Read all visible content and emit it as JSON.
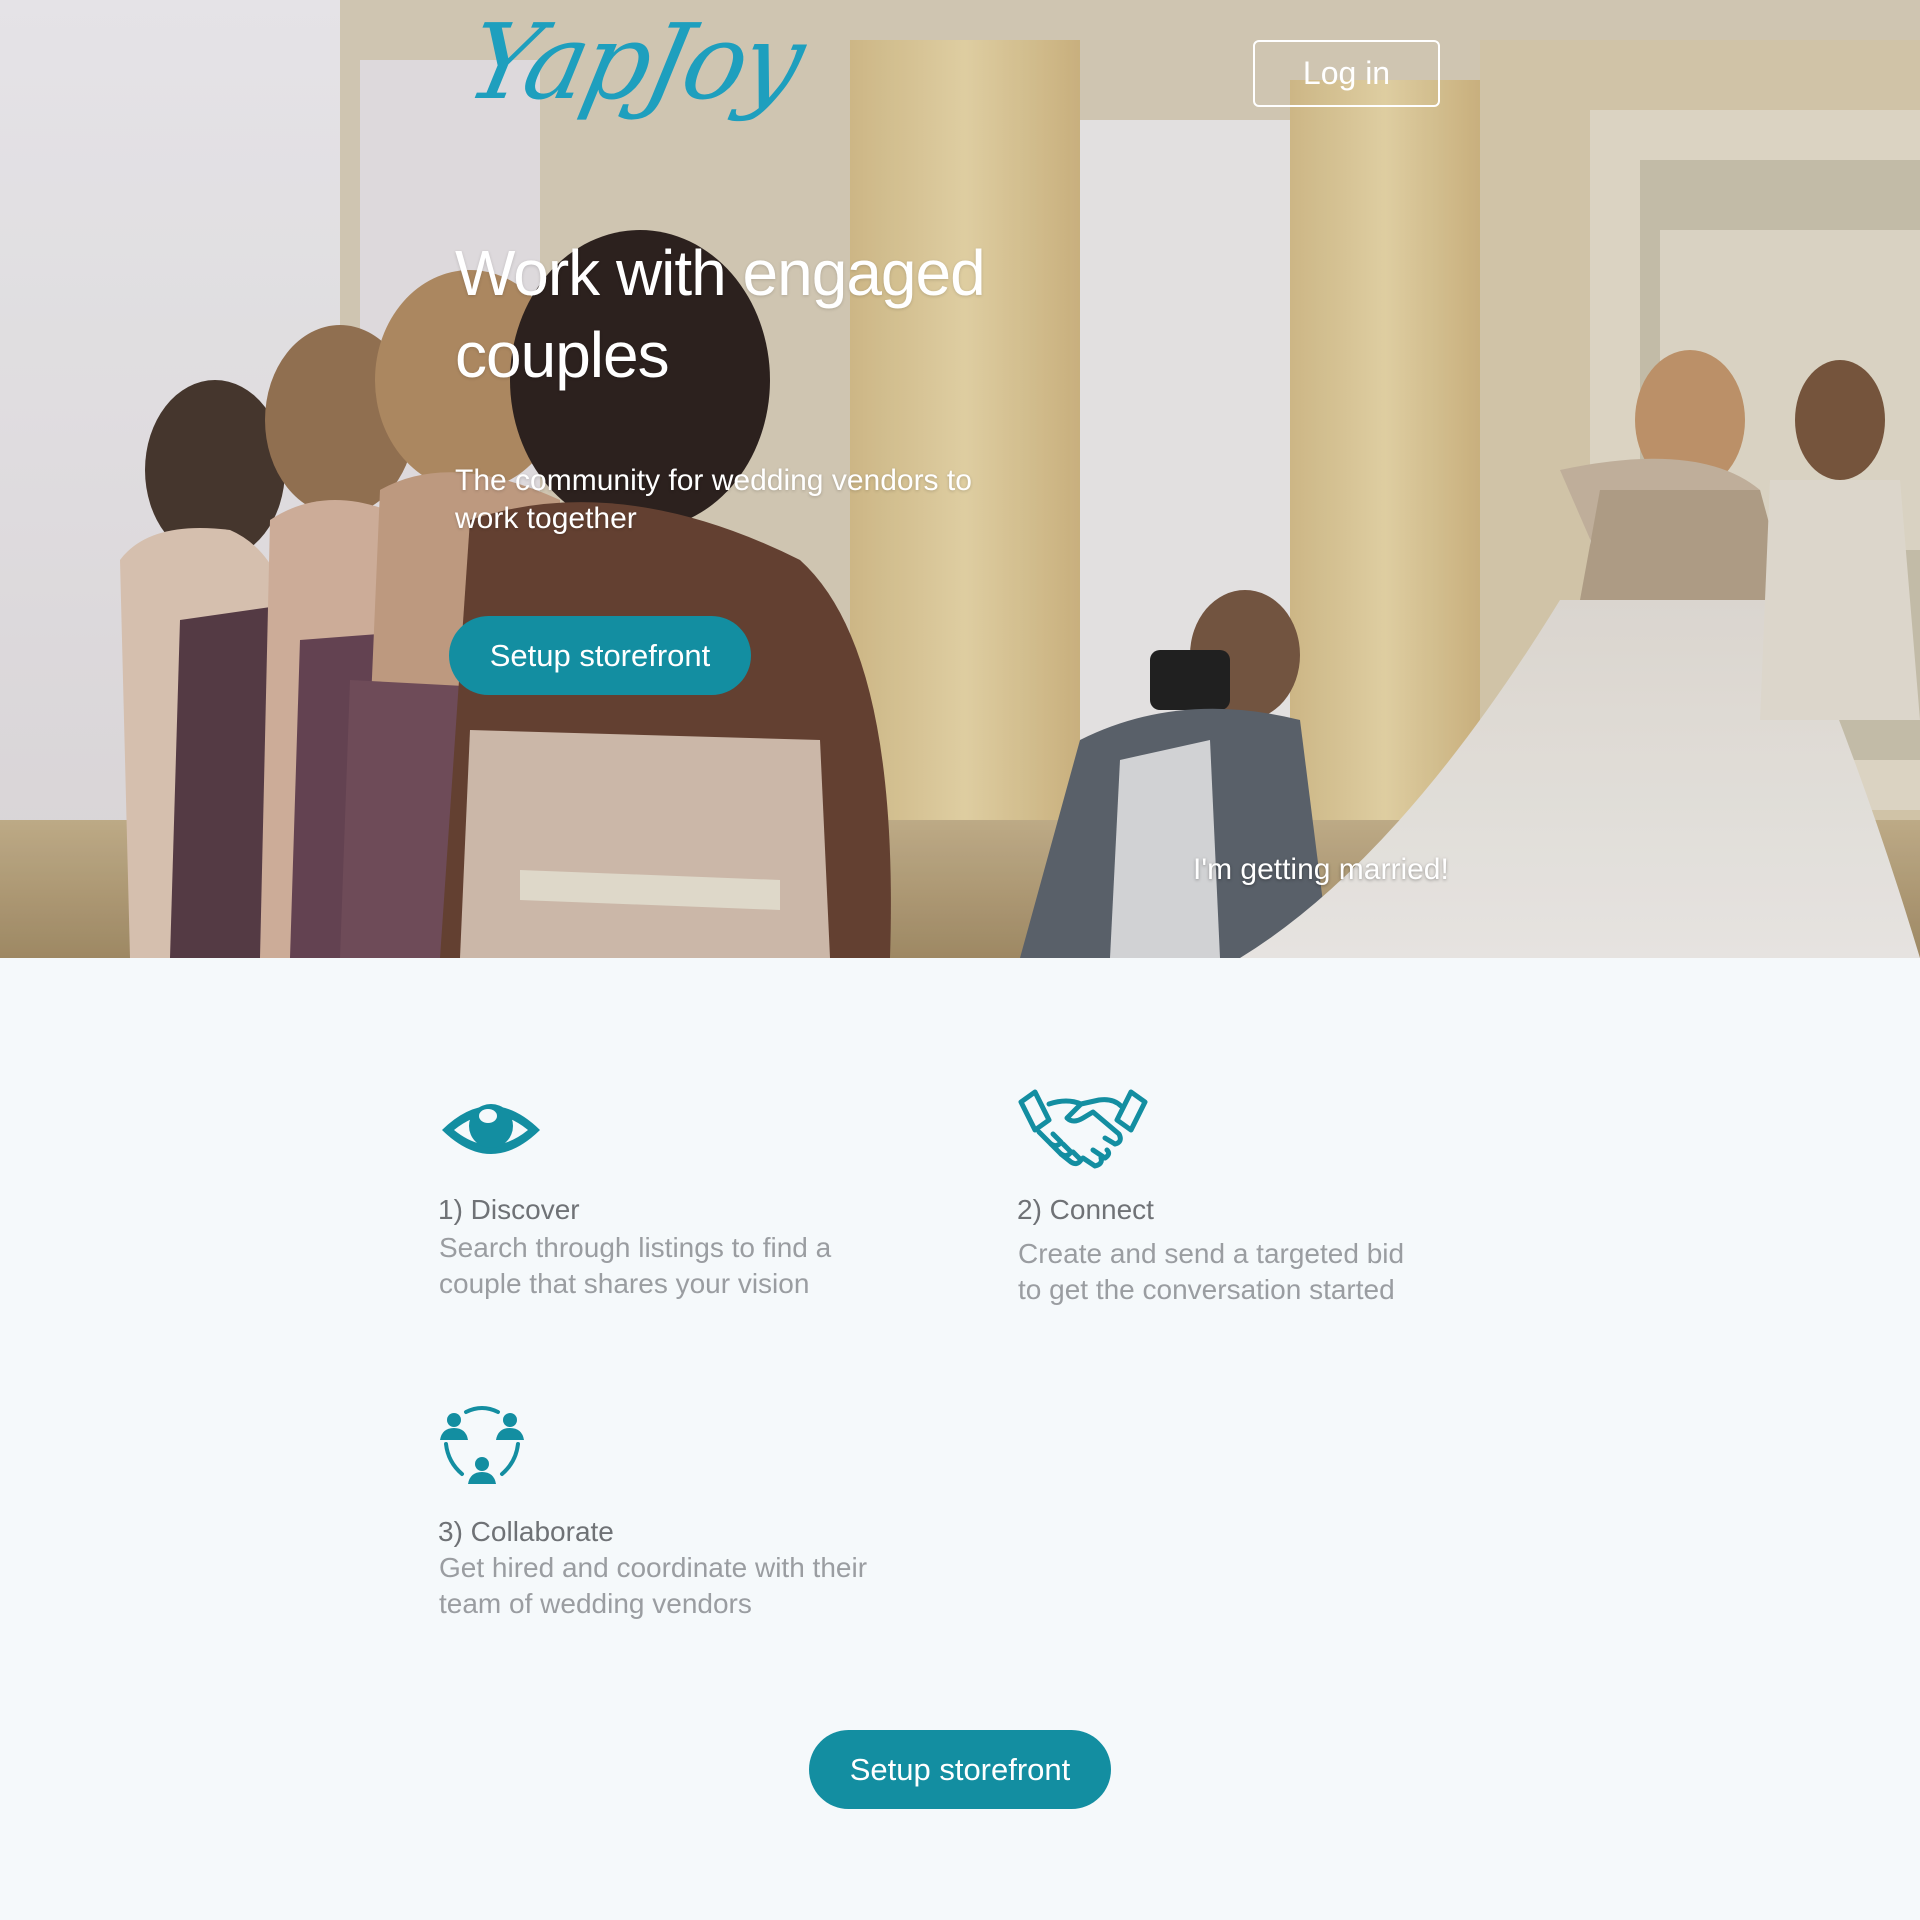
{
  "brand": {
    "logo_text": "YapJoy",
    "accent_color": "#138ea1",
    "logo_color": "#1e9fbe"
  },
  "header": {
    "login_label": "Log in"
  },
  "hero": {
    "title": "Work with engaged couples",
    "subtitle": "The community for wedding vendors to work together",
    "cta_label": "Setup storefront",
    "caption": "I'm getting married!"
  },
  "features": [
    {
      "icon": "eye-icon",
      "title": "1) Discover",
      "description": "Search through listings to find a couple that shares your vision"
    },
    {
      "icon": "handshake-icon",
      "title": "2) Connect",
      "description": "Create and send a targeted bid to get the conversation started"
    },
    {
      "icon": "team-icon",
      "title": "3) Collaborate",
      "description": "Get hired and coordinate with their team of wedding vendors"
    }
  ],
  "footer_cta": {
    "label": "Setup storefront"
  }
}
